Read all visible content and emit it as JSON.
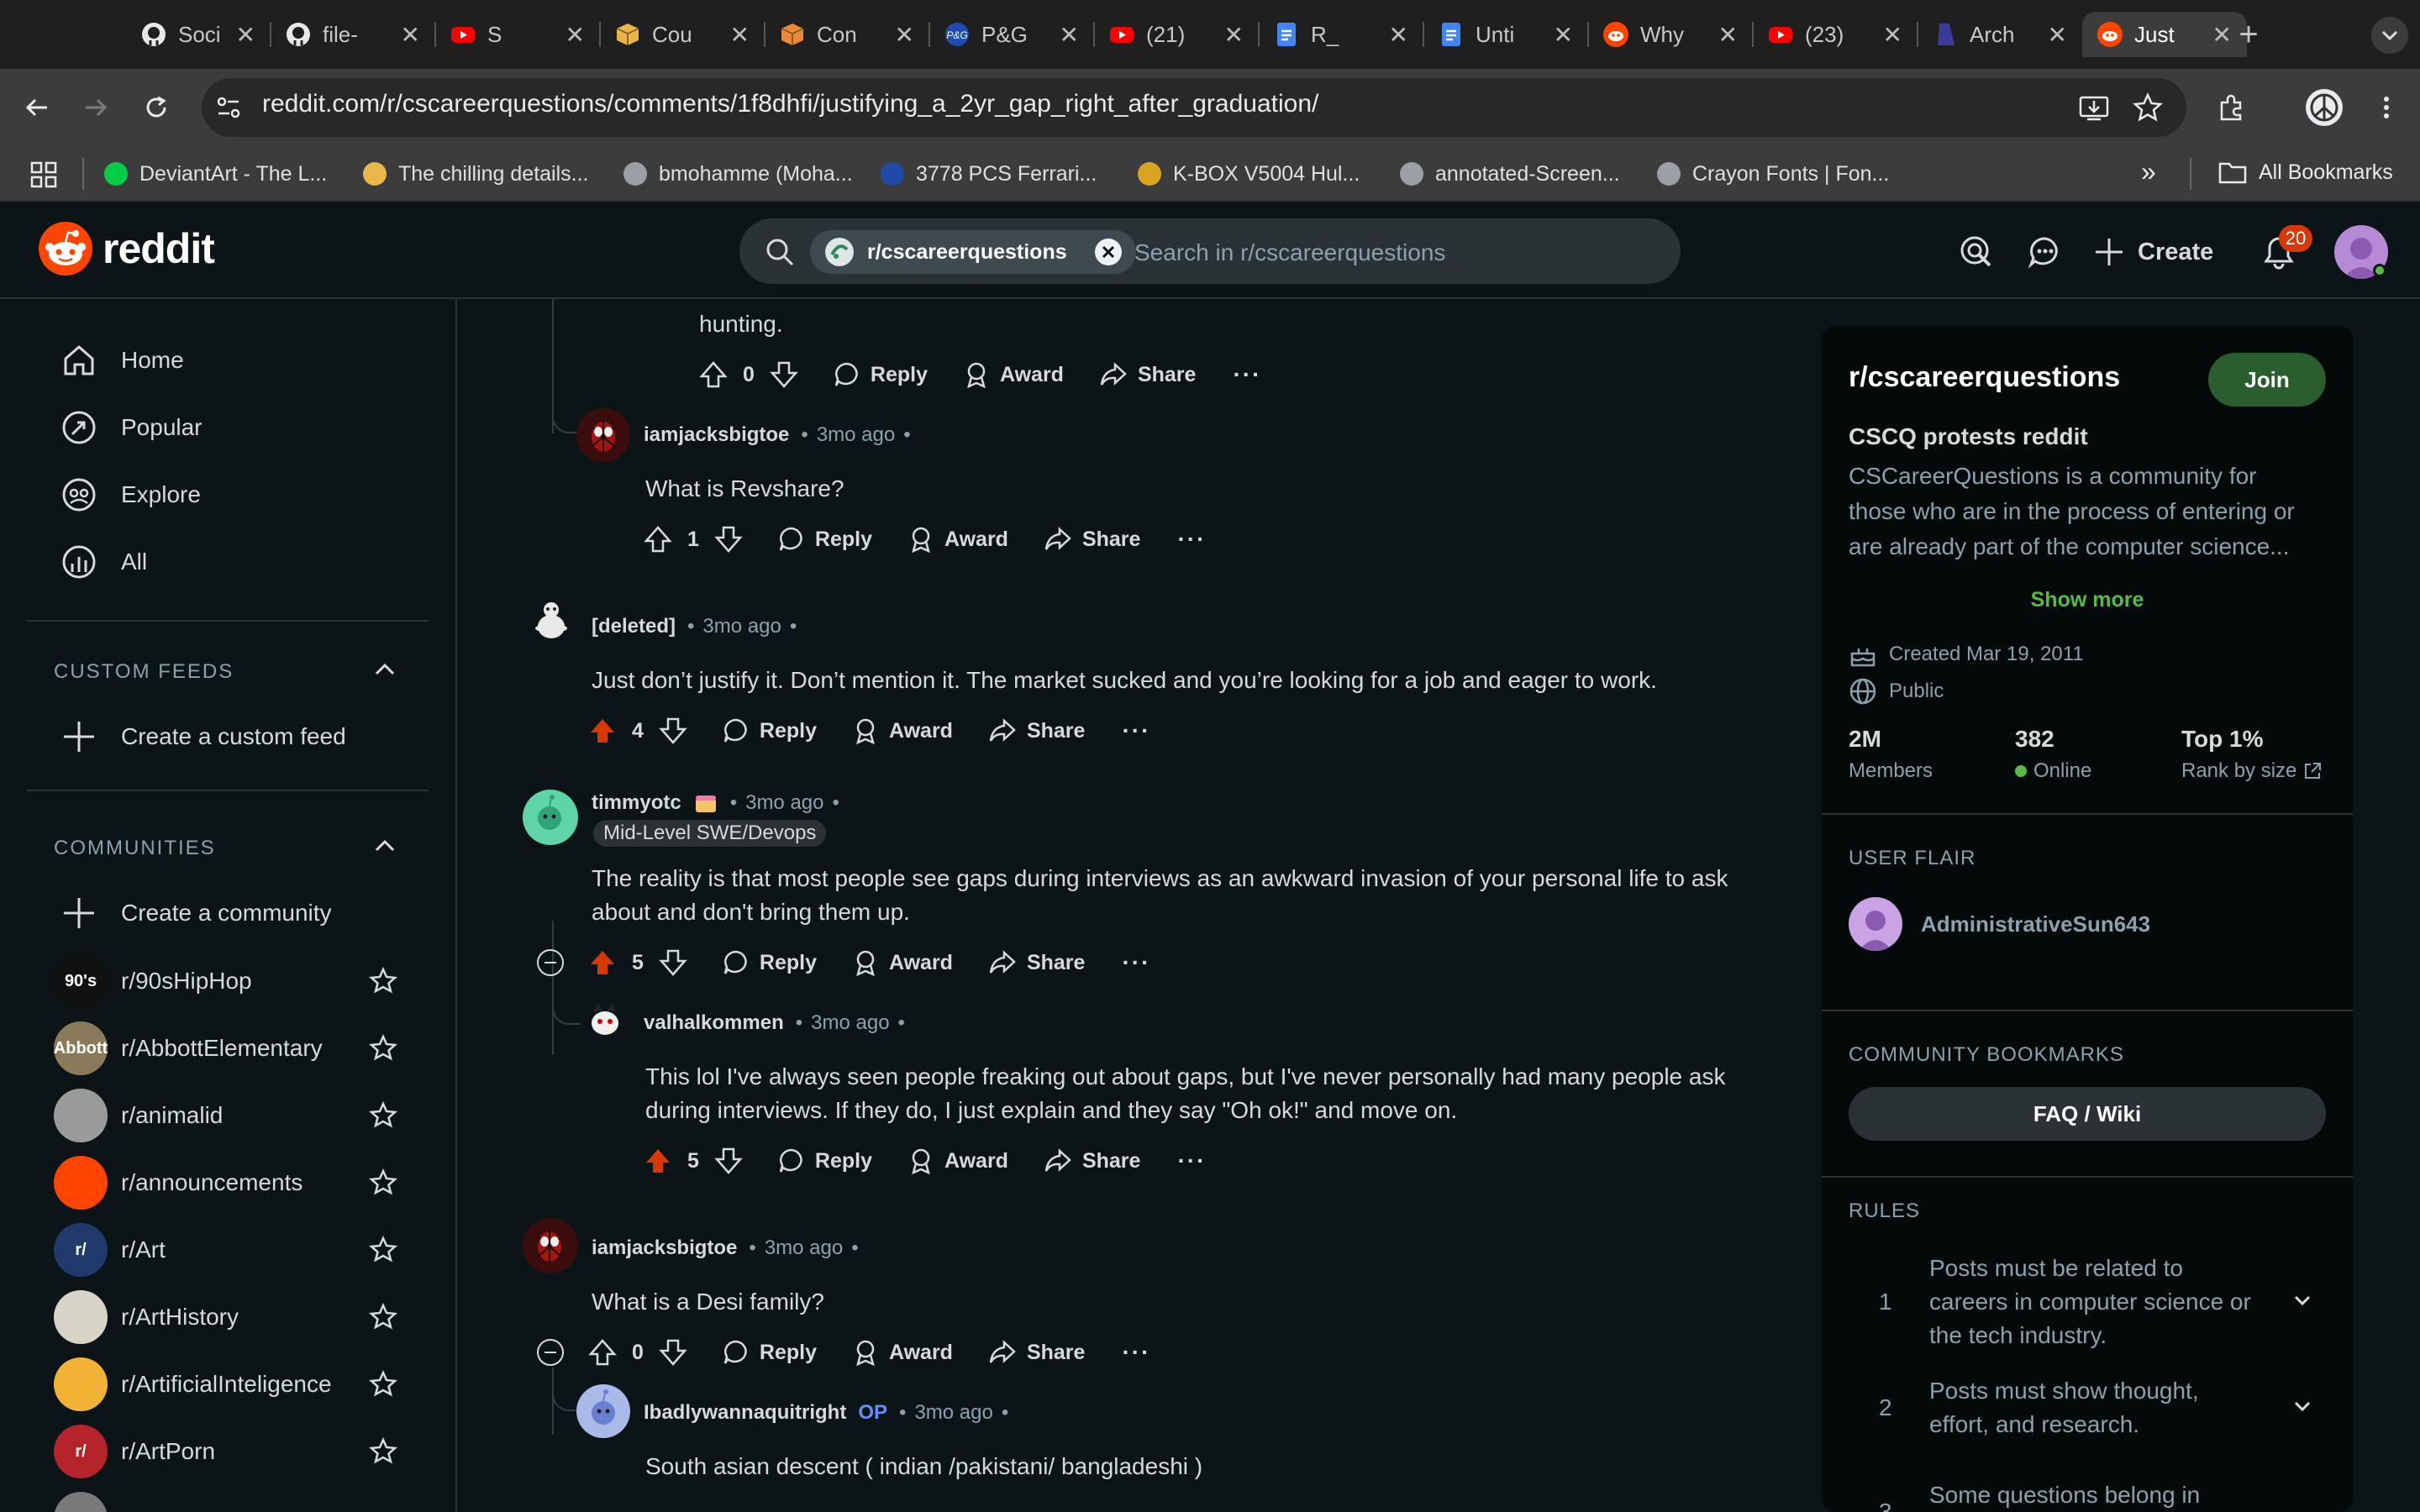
{
  "browser": {
    "tabs": [
      {
        "title": "Soci",
        "icon": "github-icon",
        "color": "#e8e8e8"
      },
      {
        "title": "file-",
        "icon": "github-icon",
        "color": "#e8e8e8"
      },
      {
        "title": "S",
        "icon": "youtube-icon",
        "color": "#ff0000"
      },
      {
        "title": "Cou",
        "icon": "package-icon",
        "color": "#e8b54b"
      },
      {
        "title": "Con",
        "icon": "package-icon",
        "color": "#e88a3a"
      },
      {
        "title": "P&G",
        "icon": "pg-icon",
        "color": "#1e4cb0"
      },
      {
        "title": "(21)",
        "icon": "youtube-icon",
        "color": "#ff0000"
      },
      {
        "title": "R_",
        "icon": "docs-icon",
        "color": "#4285f4"
      },
      {
        "title": "Unti",
        "icon": "docs-icon",
        "color": "#4285f4"
      },
      {
        "title": "Why",
        "icon": "reddit-icon",
        "color": "#ff4500"
      },
      {
        "title": "(23)",
        "icon": "youtube-icon",
        "color": "#ff0000"
      },
      {
        "title": "Arch",
        "icon": "arch-icon",
        "color": "#3b3b9a"
      },
      {
        "title": "Just",
        "icon": "reddit-icon",
        "color": "#ff4500"
      }
    ],
    "close_glyph": "✕",
    "new_tab_glyph": "+",
    "url": "reddit.com/r/cscareerquestions/comments/1f8dhfi/justifying_a_2yr_gap_right_after_graduation/",
    "bookmarks": [
      {
        "label": "DeviantArt - The L...",
        "color": "#05cc47"
      },
      {
        "label": "The chilling details...",
        "color": "#e8b84b"
      },
      {
        "label": "bmohamme (Moha...",
        "color": "#9aa0a6"
      },
      {
        "label": "3778 PCS Ferrari...",
        "color": "#1f4aa8"
      },
      {
        "label": "K-BOX V5004 Hul...",
        "color": "#d9a521"
      },
      {
        "label": "annotated-Screen...",
        "color": "#9aa0a6"
      },
      {
        "label": "Crayon Fonts | Fon...",
        "color": "#9aa0a6"
      }
    ],
    "more_bookmarks": "»",
    "all_bookmarks": "All Bookmarks"
  },
  "reddit": {
    "logo_text": "reddit",
    "search": {
      "chip": "r/cscareerquestions",
      "placeholder": "Search in r/cscareerquestions"
    },
    "create_label": "Create",
    "notification_count": "20"
  },
  "sidebar": {
    "nav": [
      {
        "label": "Home",
        "icon": "home-icon"
      },
      {
        "label": "Popular",
        "icon": "popular-icon"
      },
      {
        "label": "Explore",
        "icon": "explore-icon"
      },
      {
        "label": "All",
        "icon": "all-icon"
      }
    ],
    "custom_feeds_title": "CUSTOM FEEDS",
    "create_feed": "Create a custom feed",
    "communities_title": "COMMUNITIES",
    "create_community": "Create a community",
    "communities": [
      {
        "name": "r/90sHipHop",
        "color": "#111111",
        "abbr": "90's"
      },
      {
        "name": "r/AbbottElementary",
        "color": "#8a7a5a",
        "abbr": "Abbott"
      },
      {
        "name": "r/animalid",
        "color": "#9a9a9a",
        "abbr": ""
      },
      {
        "name": "r/announcements",
        "color": "#ff4500",
        "abbr": ""
      },
      {
        "name": "r/Art",
        "color": "#1f3a6b",
        "abbr": "r/"
      },
      {
        "name": "r/ArtHistory",
        "color": "#d8d4c8",
        "abbr": ""
      },
      {
        "name": "r/ArtificialInteligence",
        "color": "#f2b233",
        "abbr": ""
      },
      {
        "name": "r/ArtPorn",
        "color": "#b4242a",
        "abbr": "r/"
      }
    ]
  },
  "comments": {
    "c0": {
      "text": "hunting.",
      "score": "0"
    },
    "c1": {
      "user": "iamjacksbigtoe",
      "time": "3mo ago",
      "text": "What is Revshare?",
      "score": "1"
    },
    "c2": {
      "user": "[deleted]",
      "time": "3mo ago",
      "text": "Just don’t justify it. Don’t mention it. The market sucked and you’re looking for a job and eager to work.",
      "score": "4"
    },
    "c3": {
      "user": "timmyotc",
      "time": "3mo ago",
      "flair": "Mid-Level SWE/Devops",
      "text1": "The reality is that most people see gaps during interviews as an awkward invasion of your personal life to ask",
      "text2": "about and don't bring them up.",
      "score": "5"
    },
    "c4": {
      "user": "valhalkommen",
      "time": "3mo ago",
      "text1": "This lol I've always seen people freaking out about gaps, but I've never personally had many people ask",
      "text2": "during interviews. If they do, I just explain and they say \"Oh ok!\" and move on.",
      "score": "5"
    },
    "c5": {
      "user": "iamjacksbigtoe",
      "time": "3mo ago",
      "text": "What is a Desi family?",
      "score": "0"
    },
    "c6": {
      "user": "Ibadlywannaquitright",
      "op": "OP",
      "time": "3mo ago",
      "text": "South asian descent ( indian /pakistani/ bangladeshi )"
    },
    "labels": {
      "reply": "Reply",
      "award": "Award",
      "share": "Share",
      "more": "···",
      "dot": "•"
    }
  },
  "community": {
    "name": "r/cscareerquestions",
    "join": "Join",
    "tagline": "CSCQ protests reddit",
    "desc1": "CSCareerQuestions is a community for",
    "desc2": "those who are in the process of entering or",
    "desc3": "are already part of the computer science...",
    "show_more": "Show more",
    "created": "Created Mar 19, 2011",
    "visibility": "Public",
    "stats": [
      {
        "value": "2M",
        "label": "Members"
      },
      {
        "value": "382",
        "label": "Online"
      },
      {
        "value": "Top 1%",
        "label": "Rank by size"
      }
    ],
    "user_flair_title": "USER FLAIR",
    "user_flair_name": "AdministrativeSun643",
    "bookmarks_title": "COMMUNITY BOOKMARKS",
    "bookmark_button": "FAQ / Wiki",
    "rules_title": "RULES",
    "rules": [
      {
        "n": "1",
        "t1": "Posts must be related to",
        "t2": "careers in computer science or",
        "t3": "the tech industry."
      },
      {
        "n": "2",
        "t1": "Posts must show thought,",
        "t2": "effort, and research.",
        "t3": ""
      },
      {
        "n": "3",
        "t1": "Some questions belong in",
        "t2": "",
        "t3": ""
      }
    ],
    "colors": {
      "join": "#2a5e2e",
      "online": "#55bd46",
      "upvoted": "#d93900",
      "show_more": "#55bd46"
    }
  }
}
